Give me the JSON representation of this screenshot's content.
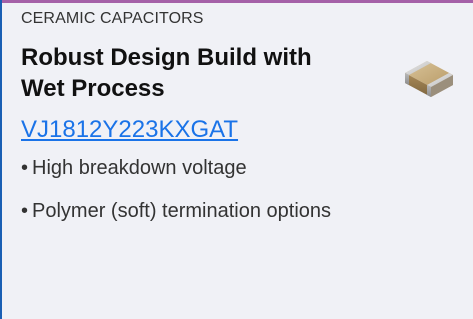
{
  "card": {
    "category": "CERAMIC CAPACITORS",
    "title": "Robust Design Build with Wet Process",
    "part_number": "VJ1812Y223KXGAT",
    "features": [
      "High breakdown voltage",
      "Polymer (soft) termination options"
    ],
    "image_icon": "ceramic-capacitor-chip-icon",
    "colors": {
      "accent_top": "#a561a8",
      "accent_left": "#1a5fb4",
      "link": "#1a73e8",
      "background": "#f0f1f6"
    }
  }
}
